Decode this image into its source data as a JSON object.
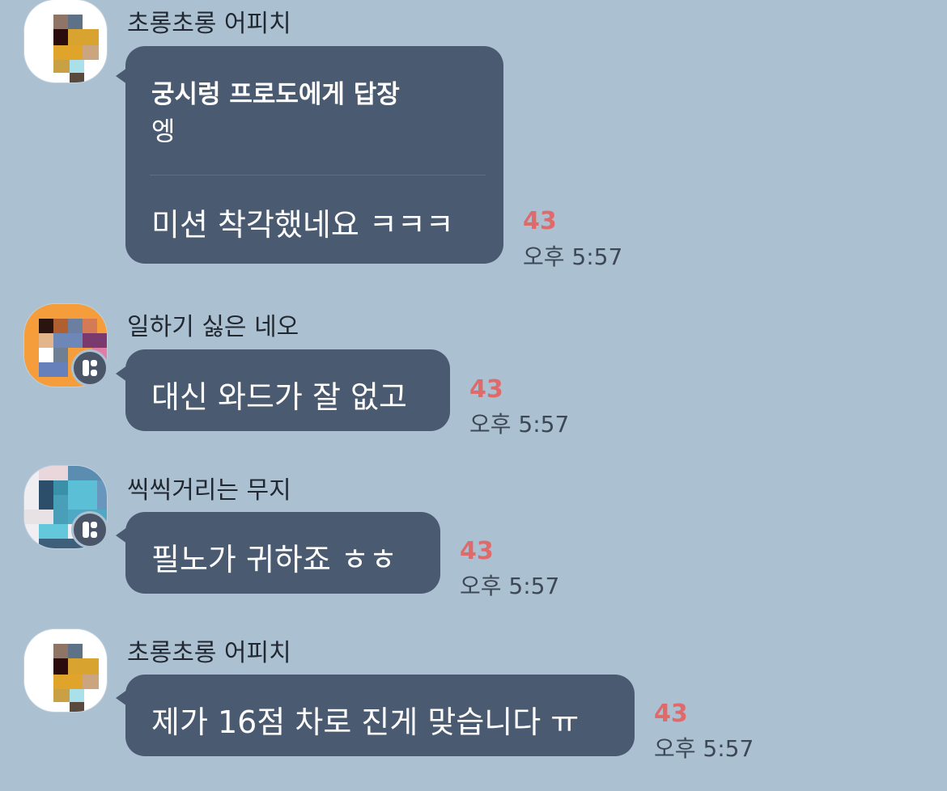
{
  "chat": {
    "messages": [
      {
        "sender": "초롱초롱 어피치",
        "reply_header": "궁시렁 프로도에게 답장",
        "reply_quote": "엥",
        "text": "미션 착각했네요 ㅋㅋㅋ",
        "unread": "43",
        "time": "오후 5:57"
      },
      {
        "sender": "일하기 싫은 네오",
        "text": "대신 와드가 잘 없고",
        "unread": "43",
        "time": "오후 5:57"
      },
      {
        "sender": "씩씩거리는 무지",
        "text": "필노가 귀하죠 ㅎㅎ",
        "unread": "43",
        "time": "오후 5:57"
      },
      {
        "sender": "초롱초롱 어피치",
        "text": "제가 16점 차로 진게 맞습니다 ㅠ",
        "unread": "43",
        "time": "오후 5:57"
      }
    ]
  },
  "colors": {
    "background": "#abc1d1",
    "bubble": "#4a5a70",
    "unread": "#e06a6a"
  },
  "icons": {
    "avatar": "pixelated-profile-avatar",
    "badge": "profile-badge-icon"
  }
}
